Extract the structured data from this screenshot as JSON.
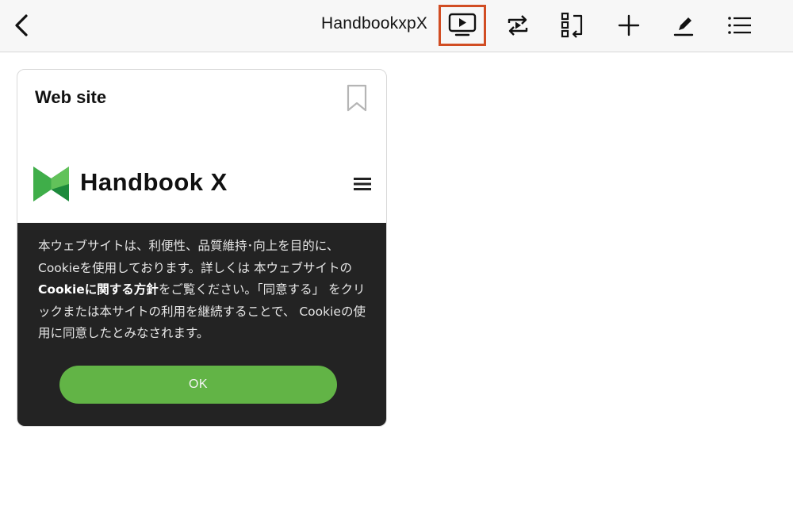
{
  "header": {
    "title": "HandbookxpX",
    "back_icon": "chevron-left-icon",
    "buttons": [
      {
        "icon": "present-screen-icon",
        "highlighted": true
      },
      {
        "icon": "loop-play-icon"
      },
      {
        "icon": "reorder-icon"
      },
      {
        "icon": "plus-icon"
      },
      {
        "icon": "pencil-icon"
      },
      {
        "icon": "list-icon"
      }
    ],
    "highlight_color": "#d14d23"
  },
  "card": {
    "title": "Web site",
    "bookmark_icon": "bookmark-icon",
    "site_logo_text": "Handbook X",
    "menu_icon": "hamburger-icon",
    "cookie": {
      "text_1": "本ウェブサイトは、利便性、品質維持･向上を目的に、Cookieを使用しております。詳しくは 本ウェブサイトの",
      "text_bold": "Cookieに関する方針",
      "text_2": "をご覧ください。「同意する」 をクリックまたは本サイトの利用を継続することで、 Cookieの使用に同意したとみなされます。",
      "ok_label": "OK",
      "panel_color": "#232323",
      "button_color": "#62b446"
    },
    "logo_colors": [
      "#1d8a3c",
      "#3fae49",
      "#62c25a"
    ]
  }
}
